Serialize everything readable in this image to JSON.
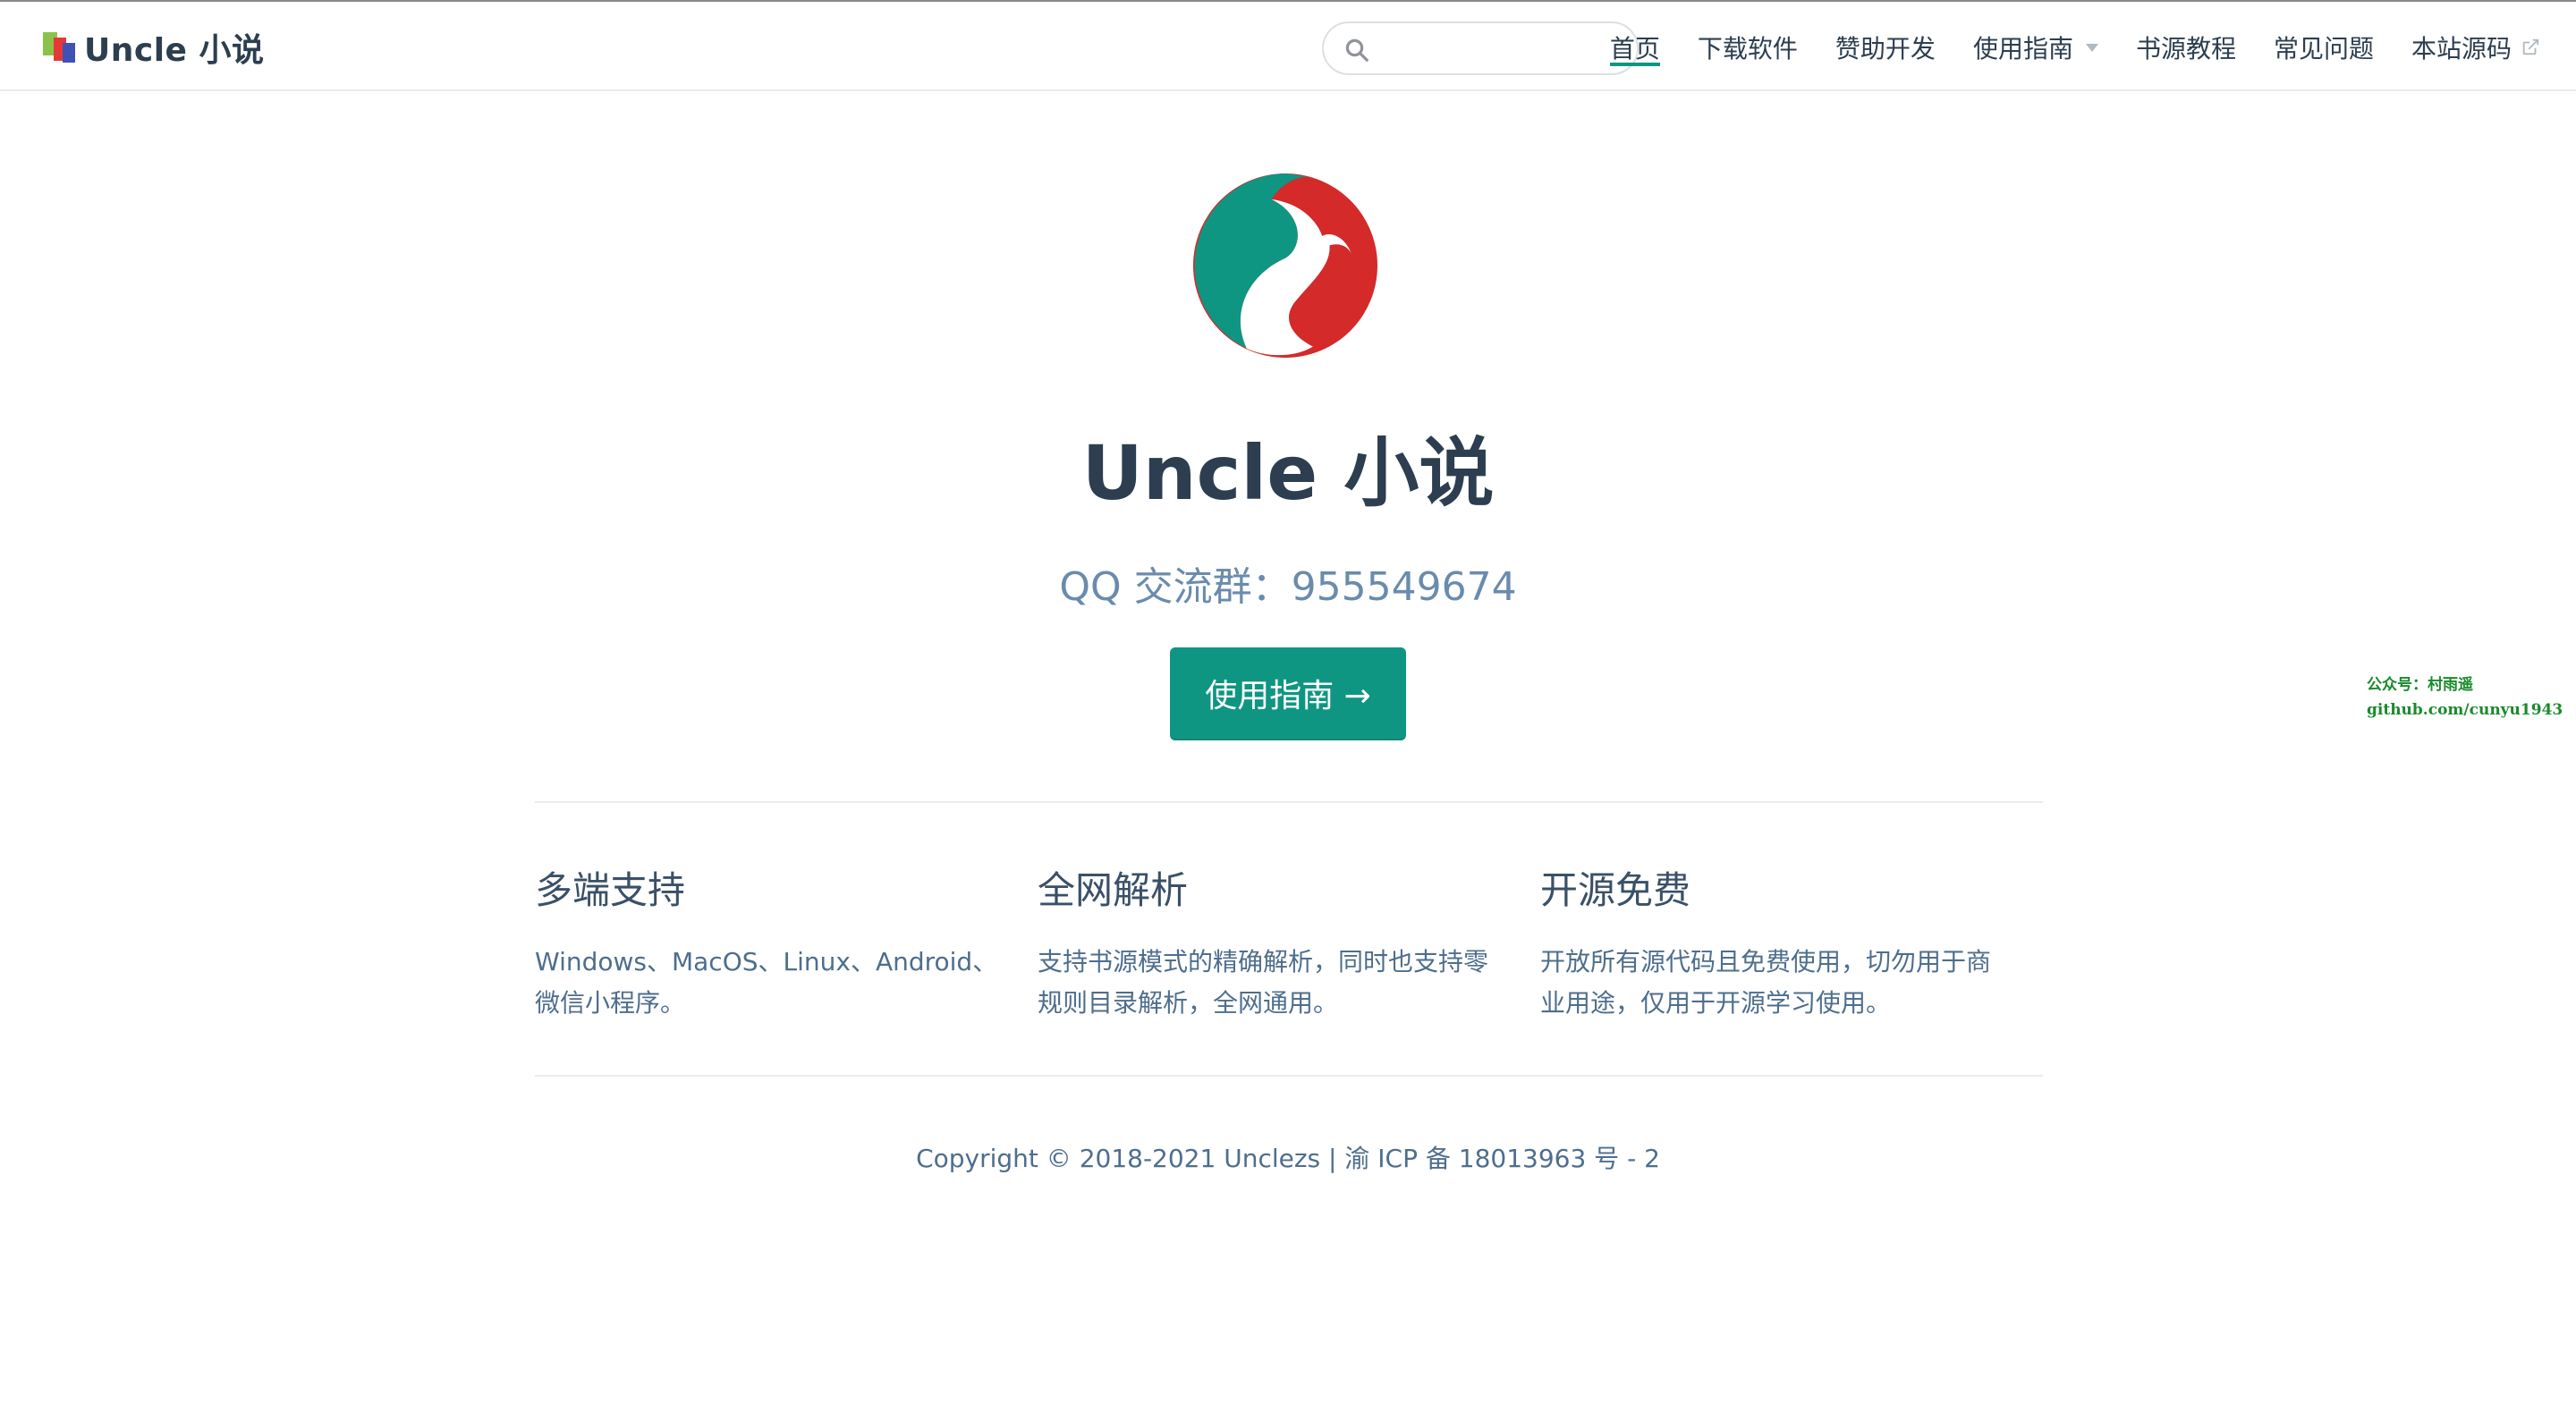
{
  "navbar": {
    "brand": "Uncle 小说",
    "search_placeholder": "",
    "links": [
      {
        "label": "首页"
      },
      {
        "label": "下载软件"
      },
      {
        "label": "赞助开发"
      },
      {
        "label": "使用指南"
      },
      {
        "label": "书源教程"
      },
      {
        "label": "常见问题"
      },
      {
        "label": "本站源码"
      }
    ]
  },
  "hero": {
    "title": "Uncle 小说",
    "description": "QQ 交流群：955549674",
    "action_label": "使用指南 →"
  },
  "watermark": {
    "line1": "公众号：村雨遥",
    "line2": "github.com/cunyu1943"
  },
  "features": [
    {
      "title": "多端支持",
      "details": "Windows、MacOS、Linux、Android、微信小程序。"
    },
    {
      "title": "全网解析",
      "details": "支持书源模式的精确解析，同时也支持零规则目录解析，全网通用。"
    },
    {
      "title": "开源免费",
      "details": "开放所有源代码且免费使用，切勿用于商业用途，仅用于开源学习使用。"
    }
  ],
  "footer": "Copyright © 2018-2021 Unclezs | 渝 ICP 备 18013963 号 - 2",
  "colors": {
    "accent": "#0f9682",
    "text": "#2c3e50",
    "muted": "#6a8bad",
    "logo_green": "#0f9682",
    "logo_red": "#d42a2a"
  },
  "icons": {
    "search": "search-icon",
    "external": "external-link-icon",
    "dropdown": "chevron-down-icon"
  }
}
